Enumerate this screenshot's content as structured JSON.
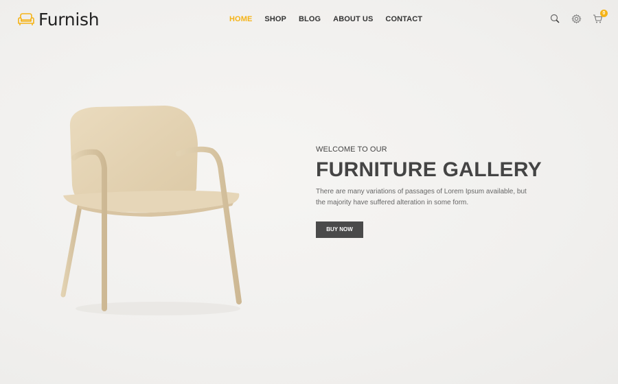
{
  "brand": {
    "name": "Furnish",
    "accent_color": "#f5b317",
    "logo_icon": "sofa-icon"
  },
  "nav": {
    "items": [
      {
        "label": "HOME",
        "active": true
      },
      {
        "label": "SHOP",
        "active": false
      },
      {
        "label": "BLOG",
        "active": false
      },
      {
        "label": "ABOUT US",
        "active": false
      },
      {
        "label": "CONTACT",
        "active": false
      }
    ]
  },
  "header_icons": {
    "search": "search-icon",
    "settings": "gear-icon",
    "cart": "cart-icon",
    "cart_count": "0"
  },
  "hero": {
    "eyebrow": "WELCOME TO OUR",
    "title": "FURNITURE GALLERY",
    "description": "There are many variations of passages of Lorem Ipsum available, but the majority have suffered alteration in some form.",
    "cta_label": "BUY NOW",
    "image": "wooden-armchair"
  }
}
